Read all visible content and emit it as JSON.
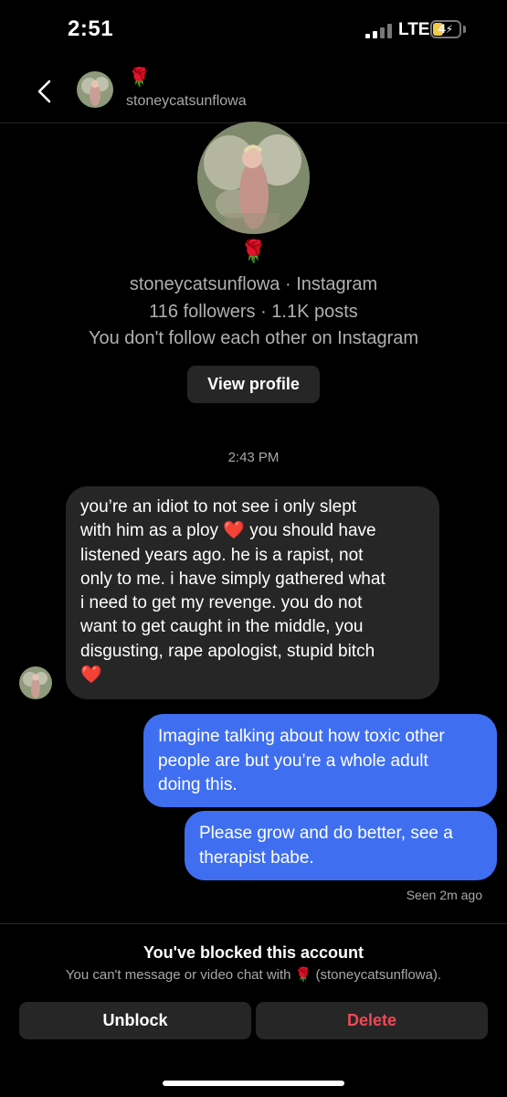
{
  "status_bar": {
    "time": "2:51",
    "network": "LTE",
    "battery": "4"
  },
  "header": {
    "rose_emoji": "🌹",
    "username": "stoneycatsunflowa"
  },
  "profile": {
    "rose_emoji": "🌹",
    "line1": "stoneycatsunflowa · Instagram",
    "line2": "116 followers · 1.1K posts",
    "line3": "You don't follow each other on Instagram",
    "view_profile_label": "View profile"
  },
  "conversation": {
    "timestamp": "2:43 PM",
    "received": [
      "you’re an idiot to not see i only slept",
      "with him as a ploy ❤️ you should have",
      "listened years ago. he is a rapist, not",
      "only to me. i have simply gathered what",
      "i need to get my revenge. you do not",
      "want to get caught in the middle, you",
      "disgusting, rape apologist, stupid bitch",
      "❤️"
    ],
    "sent": [
      {
        "lines": [
          "Imagine talking about how toxic other",
          "people are but you’re a whole adult",
          "doing this."
        ]
      },
      {
        "lines": [
          "Please grow and do better, see a",
          "therapist babe."
        ]
      }
    ],
    "seen_status": "Seen 2m ago"
  },
  "blocked": {
    "title": "You've blocked this account",
    "subtitle": "You can't message or video chat with 🌹 (stoneycatsunflowa).",
    "unblock_label": "Unblock",
    "delete_label": "Delete",
    "delete_color": "#ed4956"
  },
  "colors": {
    "sent_bubble": "#3f6ff0",
    "received_bubble": "#262626"
  }
}
